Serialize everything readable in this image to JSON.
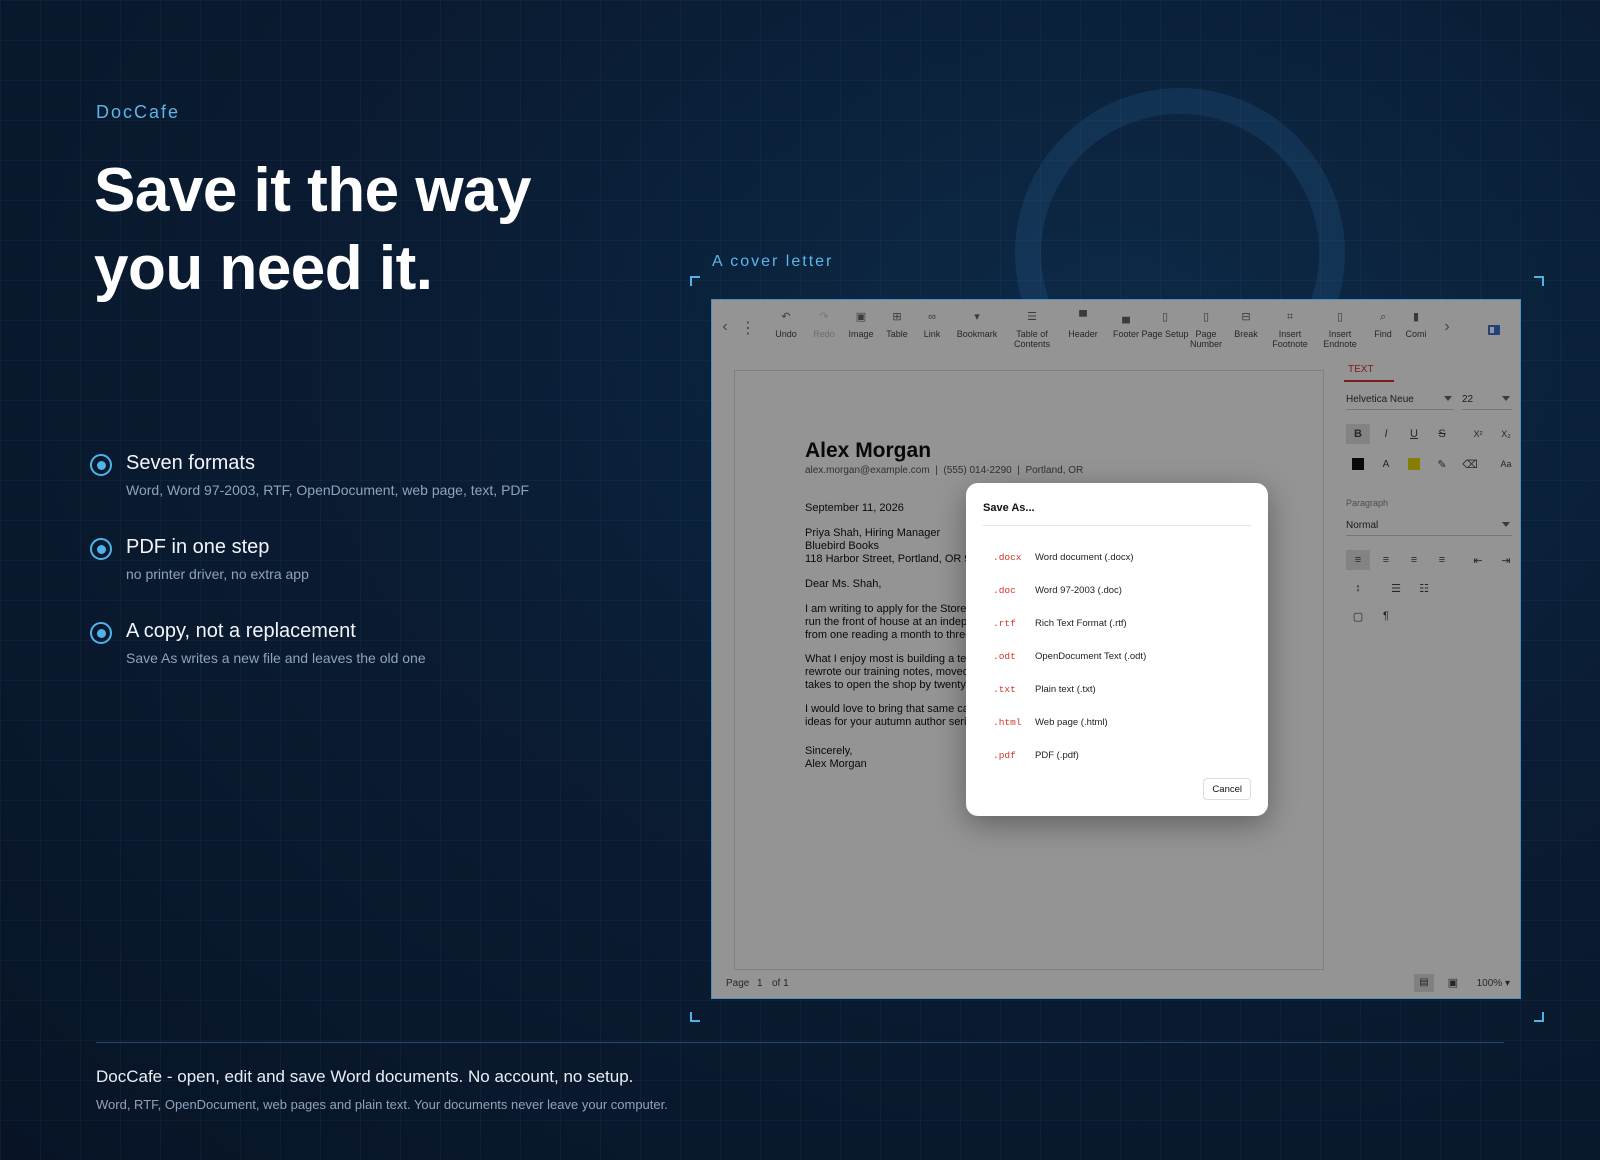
{
  "brand": "DocCafe",
  "headline": "Save it the way you need it.",
  "features": [
    {
      "title": "Seven formats",
      "desc": "Word, Word 97-2003, RTF, OpenDocument, web page, text, PDF"
    },
    {
      "title": "PDF in one step",
      "desc": "no printer driver, no extra app"
    },
    {
      "title": "A copy, not a replacement",
      "desc": "Save As writes a new file and leaves the old one"
    }
  ],
  "caption": "A cover letter",
  "toolbar": {
    "buttons": [
      {
        "label": "Undo",
        "icon": "undo-icon"
      },
      {
        "label": "Redo",
        "icon": "redo-icon",
        "disabled": true
      },
      {
        "label": "Image",
        "icon": "image-icon"
      },
      {
        "label": "Table",
        "icon": "table-icon"
      },
      {
        "label": "Link",
        "icon": "link-icon"
      },
      {
        "label": "Bookmark",
        "icon": "bookmark-icon"
      },
      {
        "label": "Table of Contents",
        "icon": "toc-icon"
      },
      {
        "label": "Header",
        "icon": "header-icon"
      },
      {
        "label": "Footer",
        "icon": "footer-icon"
      },
      {
        "label": "Page Setup",
        "icon": "page-setup-icon"
      },
      {
        "label": "Page Number",
        "icon": "page-number-icon"
      },
      {
        "label": "Break",
        "icon": "break-icon"
      },
      {
        "label": "Insert Footnote",
        "icon": "footnote-icon"
      },
      {
        "label": "Insert Endnote",
        "icon": "endnote-icon"
      },
      {
        "label": "Find",
        "icon": "find-icon"
      },
      {
        "label": "Comi",
        "icon": "comment-icon"
      }
    ]
  },
  "document": {
    "name": "Alex Morgan",
    "contact": "alex.morgan@example.com  |  (555) 014-2290  |  Portland, OR",
    "date": "September 11, 2026",
    "recipient": [
      "Priya Shah, Hiring Manager",
      "Bluebird Books",
      "118 Harbor Street, Portland, OR 9"
    ],
    "salutation": "Dear Ms. Shah,",
    "para1": [
      "I am writing to apply for the Store",
      "run the front of house at an indepe",
      "from one reading a month to three"
    ],
    "para2": [
      "What I enjoy most is building a tea",
      "rewrote our training notes, moved",
      "takes to open the shop by twenty"
    ],
    "para3": [
      "I would love to bring that same ca",
      "ideas for your autumn author serie"
    ],
    "closing": "Sincerely,",
    "signature": "Alex Morgan"
  },
  "sidebar": {
    "tab": "TEXT",
    "font": "Helvetica Neue",
    "size": "22",
    "paragraph_label": "Paragraph",
    "paragraph_style": "Normal",
    "bold": "B",
    "italic": "I",
    "underline": "U",
    "strike": "S",
    "superscript": "X²",
    "subscript": "X₂",
    "font_color_label": "A",
    "case_label": "Aa",
    "colors": {
      "text": "#111111",
      "highlight": "#e8d800"
    }
  },
  "status": {
    "page_label": "Page",
    "page": "1",
    "of": "of 1",
    "zoom": "100%"
  },
  "dialog": {
    "title": "Save As...",
    "formats": [
      {
        "ext": ".docx",
        "name": "Word document (.docx)"
      },
      {
        "ext": ".doc",
        "name": "Word 97-2003 (.doc)"
      },
      {
        "ext": ".rtf",
        "name": "Rich Text Format (.rtf)"
      },
      {
        "ext": ".odt",
        "name": "OpenDocument Text (.odt)"
      },
      {
        "ext": ".txt",
        "name": "Plain text (.txt)"
      },
      {
        "ext": ".html",
        "name": "Web page (.html)"
      },
      {
        "ext": ".pdf",
        "name": "PDF (.pdf)"
      }
    ],
    "cancel": "Cancel"
  },
  "footer": {
    "title": "DocCafe - open, edit and save Word documents. No account, no setup.",
    "subtitle": "Word, RTF, OpenDocument, web pages and plain text. Your documents never leave your computer."
  },
  "colors": {
    "accent": "#4fb3ea",
    "background": "#0a1c33",
    "format_ext": "#d0342c"
  }
}
